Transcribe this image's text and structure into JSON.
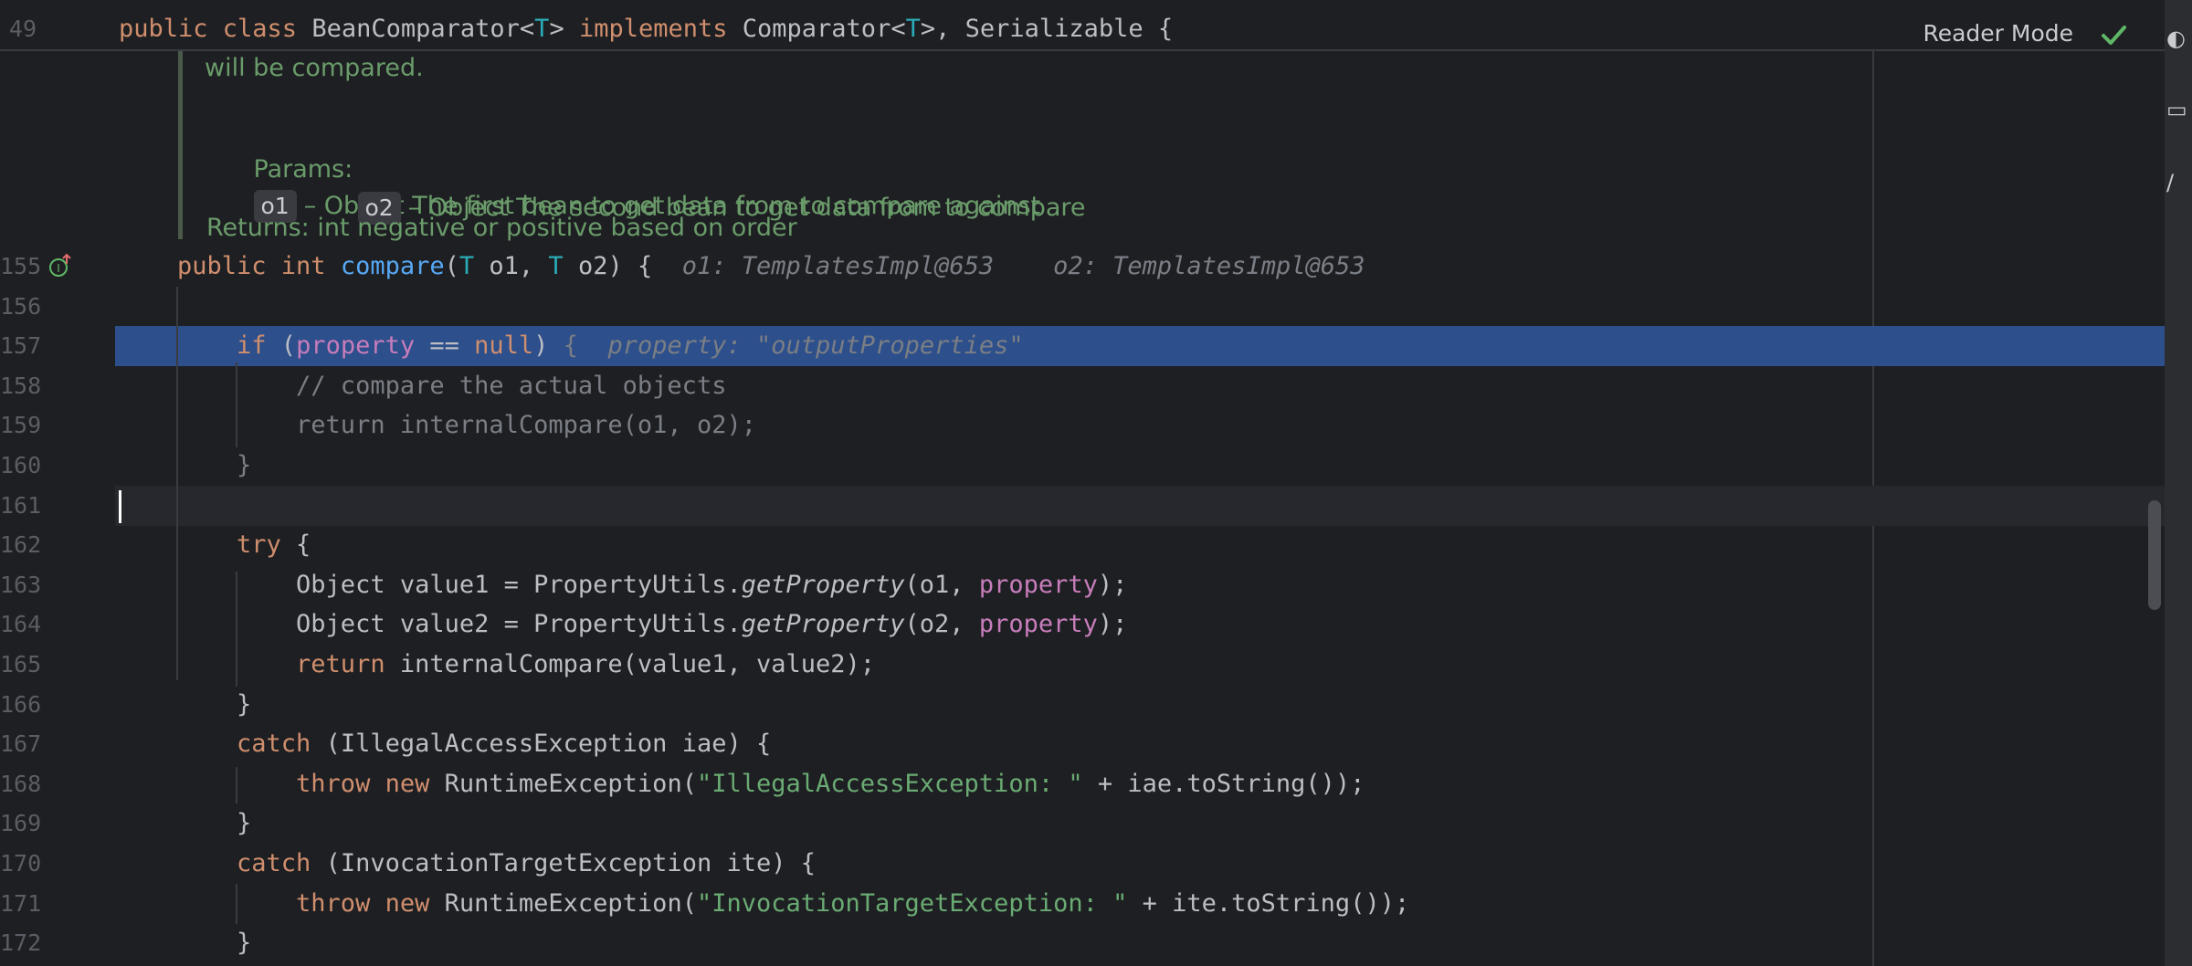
{
  "sticky_header": {
    "line_number": "49",
    "parts": [
      {
        "text": "public class ",
        "cls": "k"
      },
      {
        "text": "BeanComparator<",
        "cls": ""
      },
      {
        "text": "T",
        "cls": "t"
      },
      {
        "text": "> ",
        "cls": ""
      },
      {
        "text": "implements ",
        "cls": "k"
      },
      {
        "text": "Comparator<",
        "cls": ""
      },
      {
        "text": "T",
        "cls": "t"
      },
      {
        "text": ">, Serializable {",
        "cls": ""
      }
    ]
  },
  "reader_mode_label": "Reader Mode",
  "doc": {
    "clipped_text": "will be compared.",
    "params_label": "Params:",
    "params": [
      {
        "name": "o1",
        "desc": "– Object The first bean to get data from to compare against"
      },
      {
        "name": "o2",
        "desc": "– Object The second bean to get data from to compare"
      }
    ],
    "returns": "Returns: int negative or positive based on order"
  },
  "lines": [
    {
      "num": "155",
      "parts": [
        {
          "text": "public int ",
          "cls": "k"
        },
        {
          "text": "compare",
          "cls": "f"
        },
        {
          "text": "(",
          "cls": ""
        },
        {
          "text": "T",
          "cls": "t"
        },
        {
          "text": " o1, ",
          "cls": ""
        },
        {
          "text": "T",
          "cls": "t"
        },
        {
          "text": " o2) {  ",
          "cls": ""
        },
        {
          "text": "o1: TemplatesImpl@653    o2: TemplatesImpl@653",
          "cls": "hint"
        }
      ]
    },
    {
      "num": "156",
      "parts": []
    },
    {
      "num": "157",
      "parts": [
        {
          "text": "    if ",
          "cls": "k"
        },
        {
          "text": "(",
          "cls": ""
        },
        {
          "text": "property",
          "cls": "p"
        },
        {
          "text": " == ",
          "cls": ""
        },
        {
          "text": "null",
          "cls": "k"
        },
        {
          "text": ") ",
          "cls": ""
        },
        {
          "text": "{  ",
          "cls": "dim"
        },
        {
          "text": "property: \"outputProperties\"",
          "cls": "hint"
        }
      ]
    },
    {
      "num": "158",
      "parts": [
        {
          "text": "        // compare the actual objects",
          "cls": "dim"
        }
      ]
    },
    {
      "num": "159",
      "parts": [
        {
          "text": "        return internalCompare(o1, o2);",
          "cls": "dim"
        }
      ]
    },
    {
      "num": "160",
      "parts": [
        {
          "text": "    }",
          "cls": "dim"
        }
      ]
    },
    {
      "num": "161",
      "parts": []
    },
    {
      "num": "162",
      "parts": [
        {
          "text": "    try ",
          "cls": "k"
        },
        {
          "text": "{",
          "cls": ""
        }
      ]
    },
    {
      "num": "163",
      "parts": [
        {
          "text": "        Object value1 = PropertyUtils.",
          "cls": ""
        },
        {
          "text": "getProperty",
          "cls": "it"
        },
        {
          "text": "(o1, ",
          "cls": ""
        },
        {
          "text": "property",
          "cls": "p"
        },
        {
          "text": ");",
          "cls": ""
        }
      ]
    },
    {
      "num": "164",
      "parts": [
        {
          "text": "        Object value2 = PropertyUtils.",
          "cls": ""
        },
        {
          "text": "getProperty",
          "cls": "it"
        },
        {
          "text": "(o2, ",
          "cls": ""
        },
        {
          "text": "property",
          "cls": "p"
        },
        {
          "text": ");",
          "cls": ""
        }
      ]
    },
    {
      "num": "165",
      "parts": [
        {
          "text": "        return ",
          "cls": "k"
        },
        {
          "text": "internalCompare(value1, value2);",
          "cls": ""
        }
      ]
    },
    {
      "num": "166",
      "parts": [
        {
          "text": "    }",
          "cls": ""
        }
      ]
    },
    {
      "num": "167",
      "parts": [
        {
          "text": "    catch ",
          "cls": "k"
        },
        {
          "text": "(IllegalAccessException iae) {",
          "cls": ""
        }
      ]
    },
    {
      "num": "168",
      "parts": [
        {
          "text": "        throw new ",
          "cls": "k"
        },
        {
          "text": "RuntimeException(",
          "cls": ""
        },
        {
          "text": "\"IllegalAccessException: \"",
          "cls": "s"
        },
        {
          "text": " + iae.toString());",
          "cls": ""
        }
      ]
    },
    {
      "num": "169",
      "parts": [
        {
          "text": "    }",
          "cls": ""
        }
      ]
    },
    {
      "num": "170",
      "parts": [
        {
          "text": "    catch ",
          "cls": "k"
        },
        {
          "text": "(InvocationTargetException ite) {",
          "cls": ""
        }
      ]
    },
    {
      "num": "171",
      "parts": [
        {
          "text": "        throw new ",
          "cls": "k"
        },
        {
          "text": "RuntimeException(",
          "cls": ""
        },
        {
          "text": "\"InvocationTargetException: \"",
          "cls": "s"
        },
        {
          "text": " + ite.toString());",
          "cls": ""
        }
      ]
    },
    {
      "num": "172",
      "parts": [
        {
          "text": "    }",
          "cls": ""
        }
      ]
    }
  ],
  "selected_line": "157",
  "caret_line": "161",
  "icons": {
    "gutter": "implements-method-icon",
    "check": "checkmark-icon"
  },
  "colors": {
    "background": "#1e1f22",
    "selection": "#2d4f8b",
    "keyword": "#cf8e6d",
    "type_param": "#2aacb8",
    "string": "#6aab73",
    "field": "#c77dbb",
    "function": "#56a8f5"
  }
}
